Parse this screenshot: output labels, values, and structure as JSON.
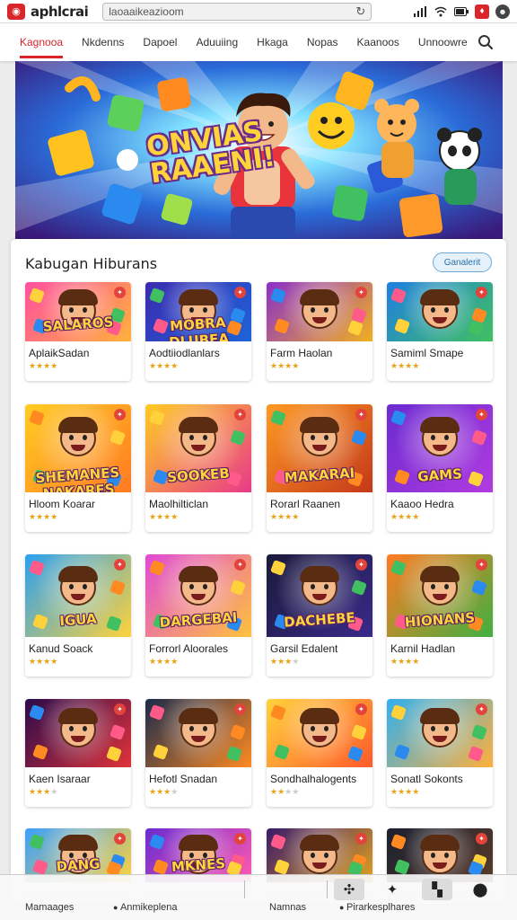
{
  "topbar": {
    "app_title": "aphlcrai",
    "url": "laoaaikeazioom",
    "reload_icon": "reload-icon",
    "icons": [
      "signal-icon",
      "wifi-icon",
      "battery-icon",
      "notification-icon",
      "profile-icon"
    ]
  },
  "nav": {
    "items": [
      "Kagnooa",
      "Nkdenns",
      "Dapoel",
      "Aduuiing",
      "Hkaga",
      "Nopas",
      "Kaanoos",
      "Unnoowre"
    ],
    "active_index": 0
  },
  "hero": {
    "title_line1": "ONVIAS",
    "title_line2": "RAAENI!"
  },
  "section": {
    "title": "Kabugan Hiburans",
    "button_label": "Ganalerit"
  },
  "games": [
    {
      "name": "AplaikSadan",
      "thumb_text": "SALAROS",
      "rating": 4,
      "bg": [
        "#ff4fa0",
        "#ffb13b"
      ]
    },
    {
      "name": "Aodtiiodlanlars",
      "thumb_text": "MOBRA DLUBEA",
      "rating": 4,
      "bg": [
        "#3b2bb0",
        "#1e63d8"
      ]
    },
    {
      "name": "Farm Haolan",
      "thumb_text": "",
      "rating": 4,
      "bg": [
        "#8b2fc9",
        "#f0b020"
      ]
    },
    {
      "name": "Samiml Smape",
      "thumb_text": "",
      "rating": 4,
      "bg": [
        "#1f7fe0",
        "#40c060"
      ]
    },
    {
      "name": "Hloom Koarar",
      "thumb_text": "SHEMANES NAKARES",
      "rating": 4,
      "bg": [
        "#ffcc22",
        "#ff7a22"
      ]
    },
    {
      "name": "Maolhilticlan",
      "thumb_text": "SOOKEB",
      "rating": 4,
      "bg": [
        "#ffcc22",
        "#e83a8a"
      ]
    },
    {
      "name": "Rorarl Raanen",
      "thumb_text": "MAKARAI",
      "rating": 4,
      "bg": [
        "#ff9a22",
        "#c4381a"
      ]
    },
    {
      "name": "Kaaoo Hedra",
      "thumb_text": "GAMS",
      "rating": 4,
      "bg": [
        "#6a2bd0",
        "#b13be0"
      ]
    },
    {
      "name": "Kanud Soack",
      "thumb_text": "IGUA",
      "rating": 4,
      "bg": [
        "#2aa0f0",
        "#ffd23b"
      ]
    },
    {
      "name": "Forrorl Aloorales",
      "thumb_text": "DARGEBAI",
      "rating": 4,
      "bg": [
        "#e04ad8",
        "#ffc23b"
      ]
    },
    {
      "name": "Garsil Edalent",
      "thumb_text": "DACHEBE",
      "rating": 3,
      "bg": [
        "#1a1a3a",
        "#3a2a8a"
      ]
    },
    {
      "name": "Karnil Hadlan",
      "thumb_text": "HIONANS",
      "rating": 4,
      "bg": [
        "#ff7a22",
        "#40b040"
      ]
    },
    {
      "name": "Kaen Isaraar",
      "thumb_text": "",
      "rating": 3,
      "bg": [
        "#2a0a4a",
        "#e0333a"
      ]
    },
    {
      "name": "Hefotl Snadan",
      "thumb_text": "",
      "rating": 3,
      "bg": [
        "#1a2a4a",
        "#ff8a22"
      ]
    },
    {
      "name": "Sondhalhalogents",
      "thumb_text": "",
      "rating": 2,
      "bg": [
        "#ffd23b",
        "#ff5a2a"
      ]
    },
    {
      "name": "Sonatl Sokonts",
      "thumb_text": "",
      "rating": 4,
      "bg": [
        "#30b0f0",
        "#ffb03b"
      ]
    },
    {
      "name": "",
      "thumb_text": "DANG",
      "rating": 0,
      "bg": [
        "#3aa0ff",
        "#ffd23b"
      ]
    },
    {
      "name": "",
      "thumb_text": "MKNES",
      "rating": 0,
      "bg": [
        "#6a2bd0",
        "#ff5ab0"
      ]
    },
    {
      "name": "",
      "thumb_text": "",
      "rating": 0,
      "bg": [
        "#3a1a6a",
        "#e0a020"
      ]
    },
    {
      "name": "",
      "thumb_text": "",
      "rating": 0,
      "bg": [
        "#1a2030",
        "#5a3a2a"
      ]
    }
  ],
  "bottombar": {
    "items": [
      {
        "label": "Mamaages",
        "icon": ""
      },
      {
        "label": "Anmikeplena",
        "icon": "circle-icon"
      },
      {
        "label": "Namnas",
        "icon": ""
      },
      {
        "label": "Pirarkesplhares",
        "icon": "ball-icon"
      }
    ],
    "right_icons": [
      "puzzle-icon",
      "star-icon",
      "gallery-icon",
      "location-icon"
    ]
  },
  "colors": {
    "accent": "#d9262b",
    "button_border": "#6aa8d8",
    "star": "#e8a317"
  }
}
